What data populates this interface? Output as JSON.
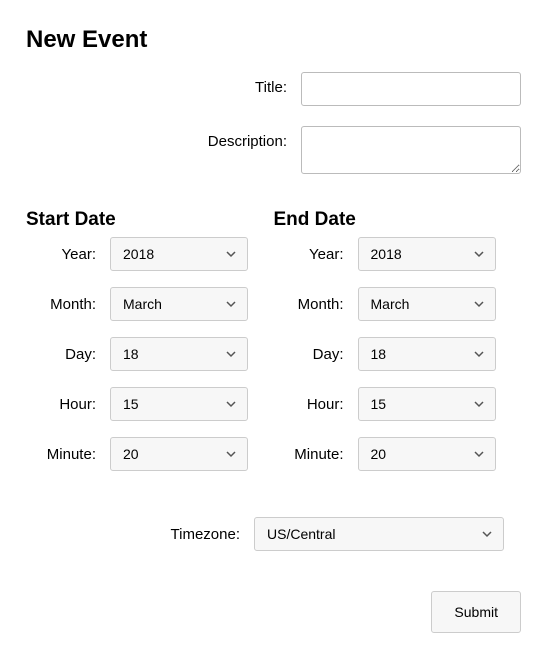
{
  "heading": "New Event",
  "title": {
    "label": "Title:",
    "value": ""
  },
  "description": {
    "label": "Description:",
    "value": ""
  },
  "start": {
    "heading": "Start Date",
    "year": {
      "label": "Year:",
      "value": "2018"
    },
    "month": {
      "label": "Month:",
      "value": "March"
    },
    "day": {
      "label": "Day:",
      "value": "18"
    },
    "hour": {
      "label": "Hour:",
      "value": "15"
    },
    "minute": {
      "label": "Minute:",
      "value": "20"
    }
  },
  "end": {
    "heading": "End Date",
    "year": {
      "label": "Year:",
      "value": "2018"
    },
    "month": {
      "label": "Month:",
      "value": "March"
    },
    "day": {
      "label": "Day:",
      "value": "18"
    },
    "hour": {
      "label": "Hour:",
      "value": "15"
    },
    "minute": {
      "label": "Minute:",
      "value": "20"
    }
  },
  "timezone": {
    "label": "Timezone:",
    "value": "US/Central"
  },
  "submit_label": "Submit"
}
